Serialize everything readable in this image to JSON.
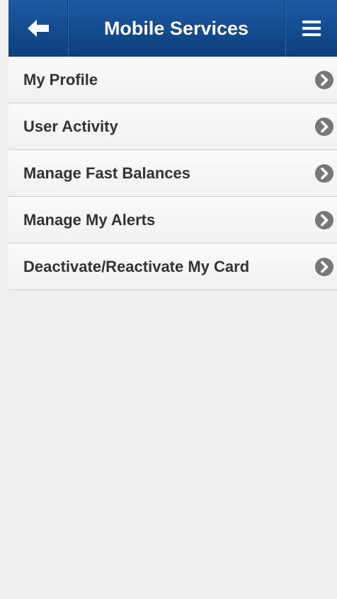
{
  "header": {
    "title": "Mobile Services",
    "back_icon": "arrow-left-icon",
    "menu_icon": "hamburger-menu-icon",
    "colors": {
      "bar": "#134b8f",
      "title": "#ffffff"
    }
  },
  "menu": {
    "items": [
      {
        "label": "My Profile"
      },
      {
        "label": "User Activity"
      },
      {
        "label": "Manage Fast Balances"
      },
      {
        "label": "Manage My Alerts"
      },
      {
        "label": "Deactivate/Reactivate My Card"
      }
    ],
    "chevron_icon": "chevron-right-circle-icon",
    "colors": {
      "label": "#333333",
      "chevron": "#777777",
      "background": "#f0f0f0"
    }
  }
}
